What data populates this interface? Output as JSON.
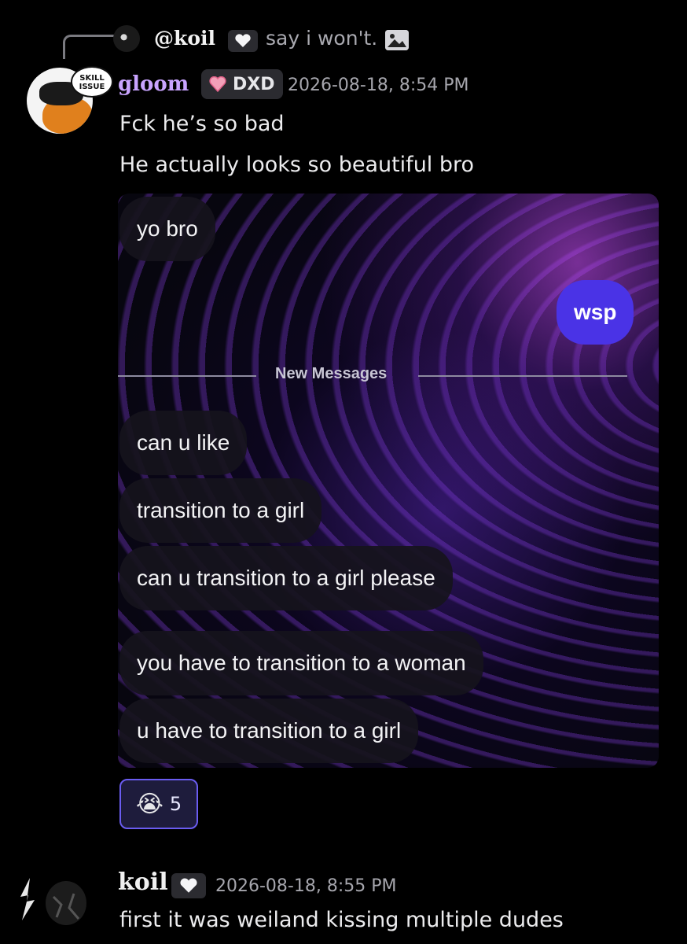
{
  "reply": {
    "author": "@koil",
    "text": "say i won't."
  },
  "message": {
    "author": "gloom",
    "role": "DXD",
    "timestamp": "2026-08-18, 8:54 PM",
    "avatar_badge": "SKILL ISSUE",
    "lines": [
      "Fck he’s so bad",
      "He actually looks so beautiful bro"
    ],
    "attachment": {
      "bubbles_in": [
        "yo bro",
        "can u like",
        "transition to a girl",
        "can u transition to a girl please",
        "you have to transition to a woman",
        "u have to transition to a girl"
      ],
      "bubble_out": "wsp",
      "divider_label": "New Messages"
    },
    "reaction": {
      "emoji": "😭",
      "count": "5"
    }
  },
  "message2": {
    "author": "koil",
    "timestamp": "2026-08-18, 8:55 PM",
    "text": "first it was weiland kissing multiple dudes"
  },
  "colors": {
    "author_accent": "#c9a4ff",
    "reaction_border": "#6a5cf0",
    "outgoing_bubble": "#4a33e6"
  }
}
